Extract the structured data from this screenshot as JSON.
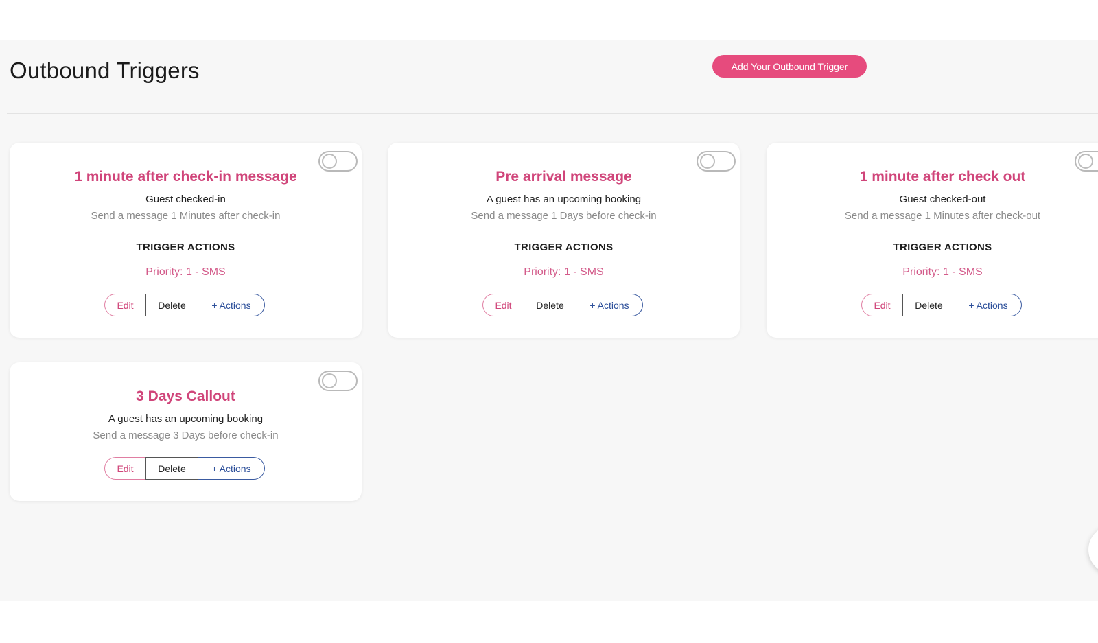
{
  "header": {
    "title": "Outbound Triggers",
    "add_button_label": "Add Your Outbound Trigger"
  },
  "colors": {
    "accent": "#e64b7d",
    "title_pink": "#d0457a",
    "actions_blue": "#2c4f9a",
    "panel_bg": "#f7f7f7"
  },
  "cards": [
    {
      "title": "1 minute after check-in message",
      "event": "Guest checked-in",
      "description": "Send a message 1 Minutes after check-in",
      "trigger_actions_label": "TRIGGER ACTIONS",
      "priority": "Priority: 1 - SMS",
      "toggle_on": false,
      "edit_label": "Edit",
      "delete_label": "Delete",
      "actions_label": "+ Actions"
    },
    {
      "title": "Pre arrival message",
      "event": "A guest has an upcoming booking",
      "description": "Send a message 1 Days before check-in",
      "trigger_actions_label": "TRIGGER ACTIONS",
      "priority": "Priority: 1 - SMS",
      "toggle_on": false,
      "edit_label": "Edit",
      "delete_label": "Delete",
      "actions_label": "+ Actions"
    },
    {
      "title": "1 minute after check out",
      "event": "Guest checked-out",
      "description": "Send a message 1 Minutes after check-out",
      "trigger_actions_label": "TRIGGER ACTIONS",
      "priority": "Priority: 1 - SMS",
      "toggle_on": false,
      "edit_label": "Edit",
      "delete_label": "Delete",
      "actions_label": "+ Actions"
    },
    {
      "title": "3 Days Callout",
      "event": "A guest has an upcoming booking",
      "description": "Send a message 3 Days before check-in",
      "toggle_on": false,
      "edit_label": "Edit",
      "delete_label": "Delete",
      "actions_label": "+ Actions"
    }
  ]
}
